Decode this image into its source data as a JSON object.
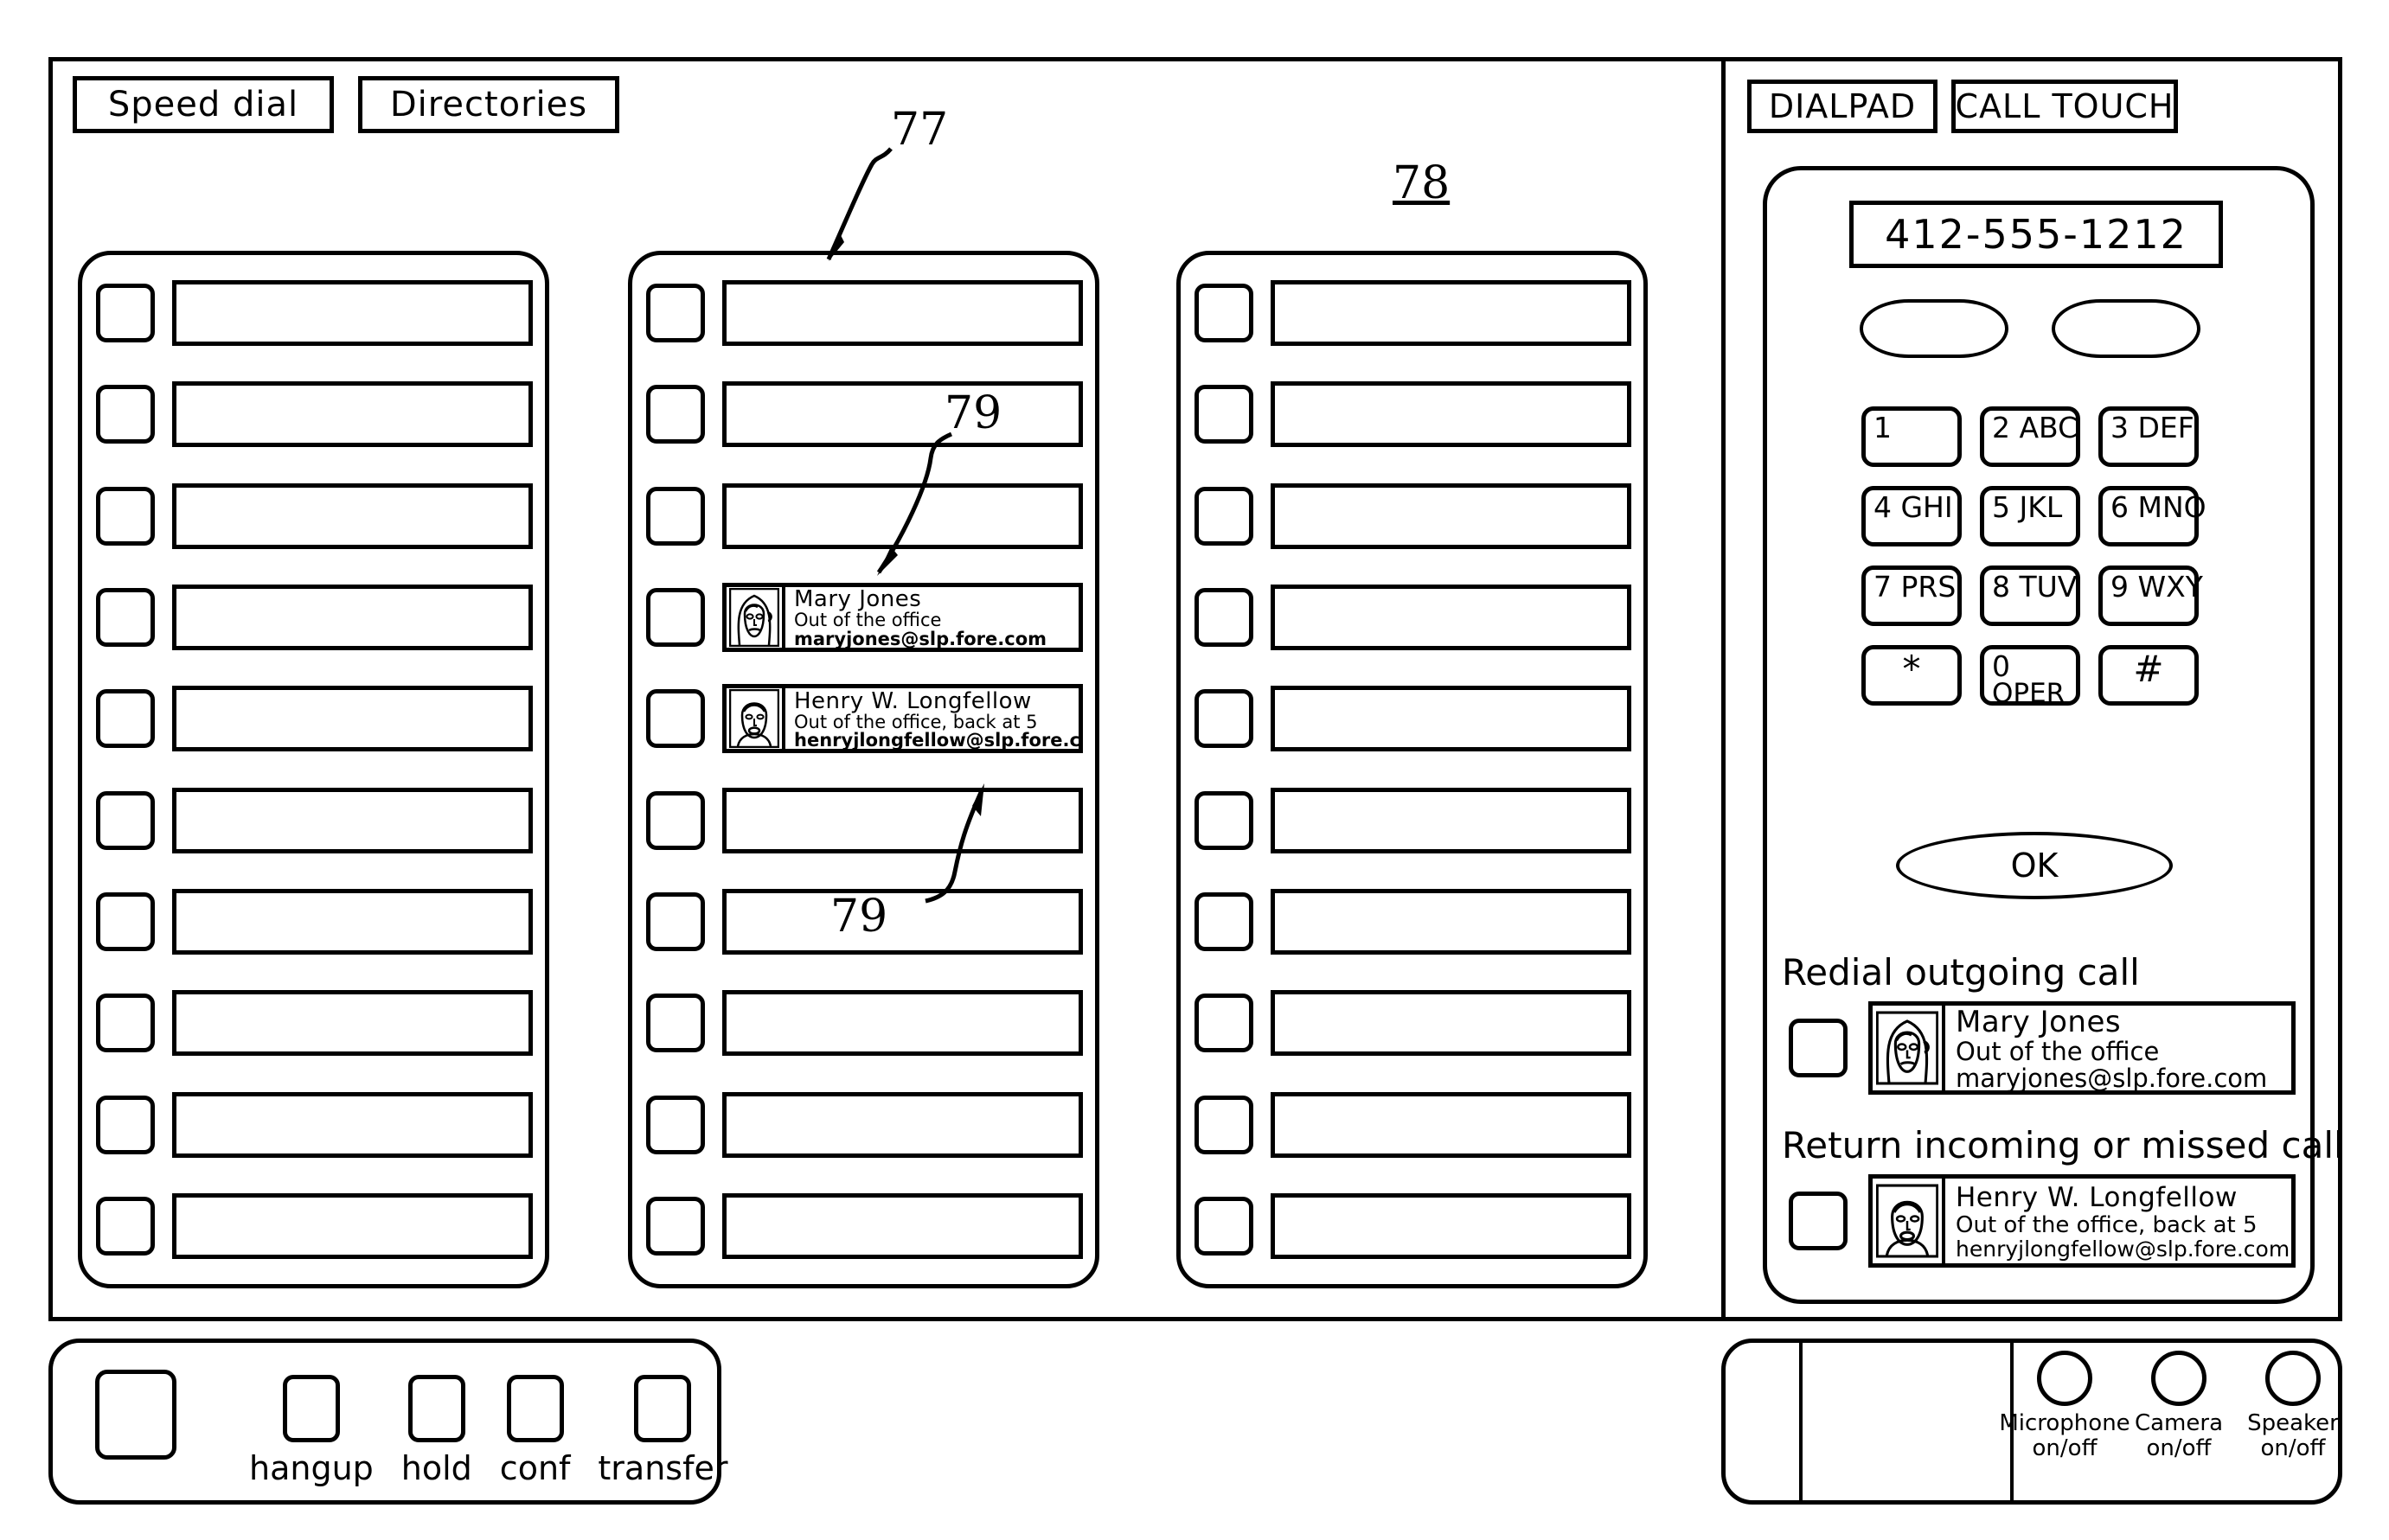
{
  "tabs": {
    "speed_dial": "Speed dial",
    "directories": "Directories",
    "dialpad": "DIALPAD",
    "call_touch": "CALL TOUCH"
  },
  "reference_numerals": {
    "ref_77": "77",
    "ref_78": "78",
    "ref_79_upper": "79",
    "ref_79_lower": "79"
  },
  "speed_dial": {
    "rows_per_column": 10,
    "columns": [
      {
        "id": "column-1",
        "entries": [
          null,
          null,
          null,
          null,
          null,
          null,
          null,
          null,
          null,
          null
        ]
      },
      {
        "id": "column-2",
        "entries": [
          null,
          null,
          null,
          "mary_jones",
          "henry_longfellow",
          null,
          null,
          null,
          null,
          null
        ]
      },
      {
        "id": "column-3",
        "entries": [
          null,
          null,
          null,
          null,
          null,
          null,
          null,
          null,
          null,
          null
        ]
      }
    ]
  },
  "contacts": {
    "mary_jones": {
      "name": "Mary Jones",
      "status": "Out of the office",
      "email": "maryjones@slp.fore.com",
      "avatar_icon": "female-face-icon"
    },
    "henry_longfellow": {
      "name": "Henry W. Longfellow",
      "status": "Out of the office, back at 5",
      "email": "henryjlongfellow@slp.fore.com",
      "avatar_icon": "male-face-icon"
    }
  },
  "dialpad": {
    "number_display": "412-555-1212",
    "keys": [
      {
        "digit": "1",
        "letters": ""
      },
      {
        "digit": "2",
        "letters": "ABC"
      },
      {
        "digit": "3",
        "letters": "DEF"
      },
      {
        "digit": "4",
        "letters": "GHI"
      },
      {
        "digit": "5",
        "letters": "JKL"
      },
      {
        "digit": "6",
        "letters": "MNO"
      },
      {
        "digit": "7",
        "letters": "PRS"
      },
      {
        "digit": "8",
        "letters": "TUV"
      },
      {
        "digit": "9",
        "letters": "WXY"
      },
      {
        "digit": "*",
        "letters": ""
      },
      {
        "digit": "0",
        "letters": "OPER"
      },
      {
        "digit": "#",
        "letters": ""
      }
    ],
    "ok_label": "OK"
  },
  "call_lists": {
    "redial_label": "Redial outgoing call",
    "return_label": "Return incoming or missed call",
    "redial_contact": "mary_jones",
    "return_contact": "henry_longfellow"
  },
  "bottom_bar": {
    "functions": [
      {
        "label": "hangup"
      },
      {
        "label": "hold"
      },
      {
        "label": "conf"
      },
      {
        "label": "transfer"
      }
    ]
  },
  "av_controls": [
    {
      "label_line1": "Microphone",
      "label_line2": "on/off",
      "icon": "microphone-toggle-icon"
    },
    {
      "label_line1": "Camera",
      "label_line2": "on/off",
      "icon": "camera-toggle-icon"
    },
    {
      "label_line1": "Speaker",
      "label_line2": "on/off",
      "icon": "speaker-toggle-icon"
    }
  ],
  "colors": {
    "line": "#000000",
    "background": "#ffffff"
  }
}
